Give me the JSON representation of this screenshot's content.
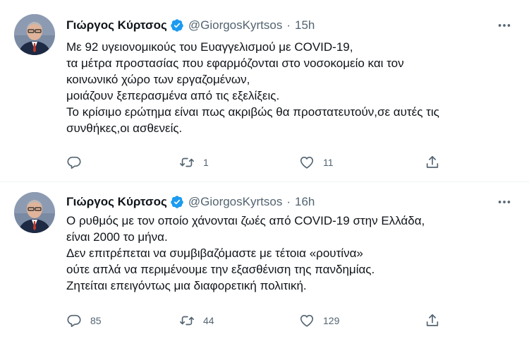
{
  "tweets": [
    {
      "author": {
        "display_name": "Γιώργος Κύρτσος",
        "handle": "@GiorgosKyrtsos",
        "verified": true
      },
      "separator": "·",
      "time": "15h",
      "lines": [
        "Με 92 υγειονομικούς του Ευαγγελισμού με COVID-19,",
        "τα μέτρα προστασίας που εφαρμόζονται στο νοσοκομείο και τον",
        "κοινωνικό χώρο των εργαζομένων,",
        "μοιάζουν ξεπερασμένα από τις εξελίξεις.",
        "Το κρίσιμο ερώτημα είναι πως ακριβώς θα προστατευτούν,σε αυτές τις",
        "συνθήκες,οι ασθενείς."
      ],
      "actions": {
        "reply_count": "",
        "retweet_count": "1",
        "like_count": "11"
      }
    },
    {
      "author": {
        "display_name": "Γιώργος Κύρτσος",
        "handle": "@GiorgosKyrtsos",
        "verified": true
      },
      "separator": "·",
      "time": "16h",
      "lines": [
        "Ο ρυθμός με τον οποίο χάνονται ζωές από COVID-19 στην Ελλάδα,",
        "είναι 2000 το μήνα.",
        "Δεν επιτρέπεται να συμβιβαζόμαστε με τέτοια «ρουτίνα»",
        "ούτε απλά να περιμένουμε την εξασθένιση της πανδημίας.",
        "Ζητείται επειγόντως μια διαφορετική πολιτική."
      ],
      "actions": {
        "reply_count": "85",
        "retweet_count": "44",
        "like_count": "129"
      }
    }
  ],
  "icons": {
    "more": "more-horizontal-icon",
    "reply": "reply-icon",
    "retweet": "retweet-icon",
    "like": "heart-icon",
    "share": "share-icon",
    "verified": "verified-badge-icon"
  },
  "colors": {
    "text_primary": "#0f1419",
    "text_secondary": "#536471",
    "verified_blue": "#1d9bf0",
    "divider": "#eff3f4"
  }
}
